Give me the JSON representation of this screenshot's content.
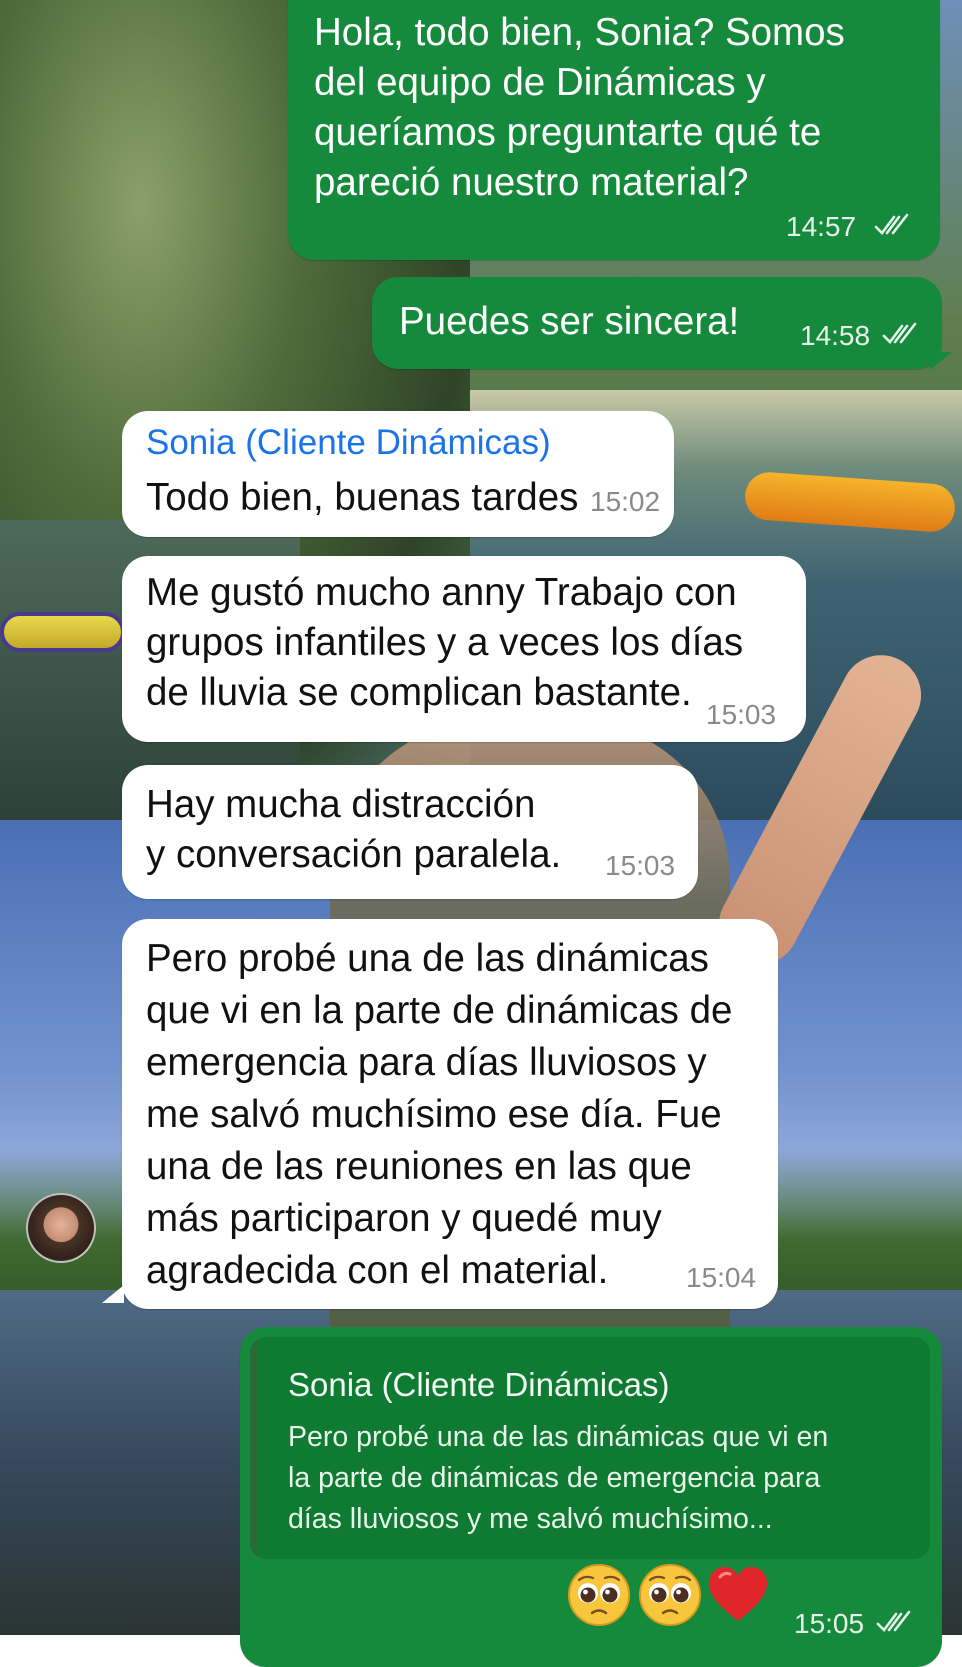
{
  "chat": {
    "messages": [
      {
        "direction": "outgoing",
        "text": "Hola, todo bien, Sonia? Somos\ndel equipo de Dinámicas y\nqueríamos preguntarte qué te\npareció nuestro material?",
        "time": "14:57",
        "status_icon": "double-check-icon"
      },
      {
        "direction": "outgoing",
        "text": "Puedes ser sincera!",
        "time": "14:58",
        "status_icon": "double-check-icon"
      },
      {
        "direction": "incoming",
        "sender": "Sonia (Cliente Dinámicas)",
        "text": "Todo bien, buenas tardes",
        "time": "15:02"
      },
      {
        "direction": "incoming",
        "text": "Me gustó mucho anny Trabajo con\ngrupos infantiles y a veces los días\nde lluvia se complican bastante.",
        "time": "15:03"
      },
      {
        "direction": "incoming",
        "text": "Hay mucha distracción\ny conversación paralela.",
        "time": "15:03"
      },
      {
        "direction": "incoming",
        "text": "Pero probé una de las dinámicas\nque vi en la parte de dinámicas de\nemergencia para días lluviosos y\nme salvó muchísimo ese día. Fue\nuna de las reuniones en las que\nmás participaron y quedé muy\nagradecida con el material.",
        "time": "15:04"
      },
      {
        "direction": "outgoing",
        "quote": {
          "sender": "Sonia (Cliente Dinámicas)",
          "text": "Pero probé una de las dinámicas que vi en\nla parte de dinámicas de emergencia para\ndías lluviosos y me salvó muchísimo..."
        },
        "emojis": [
          "pleading-face-emoji",
          "pleading-face-emoji",
          "red-heart-emoji"
        ],
        "time": "15:05",
        "status_icon": "double-check-icon"
      }
    ]
  },
  "colors": {
    "outgoing_bubble": "#168a3c",
    "incoming_bubble": "#ffffff",
    "sender_name": "#1a73e8"
  }
}
